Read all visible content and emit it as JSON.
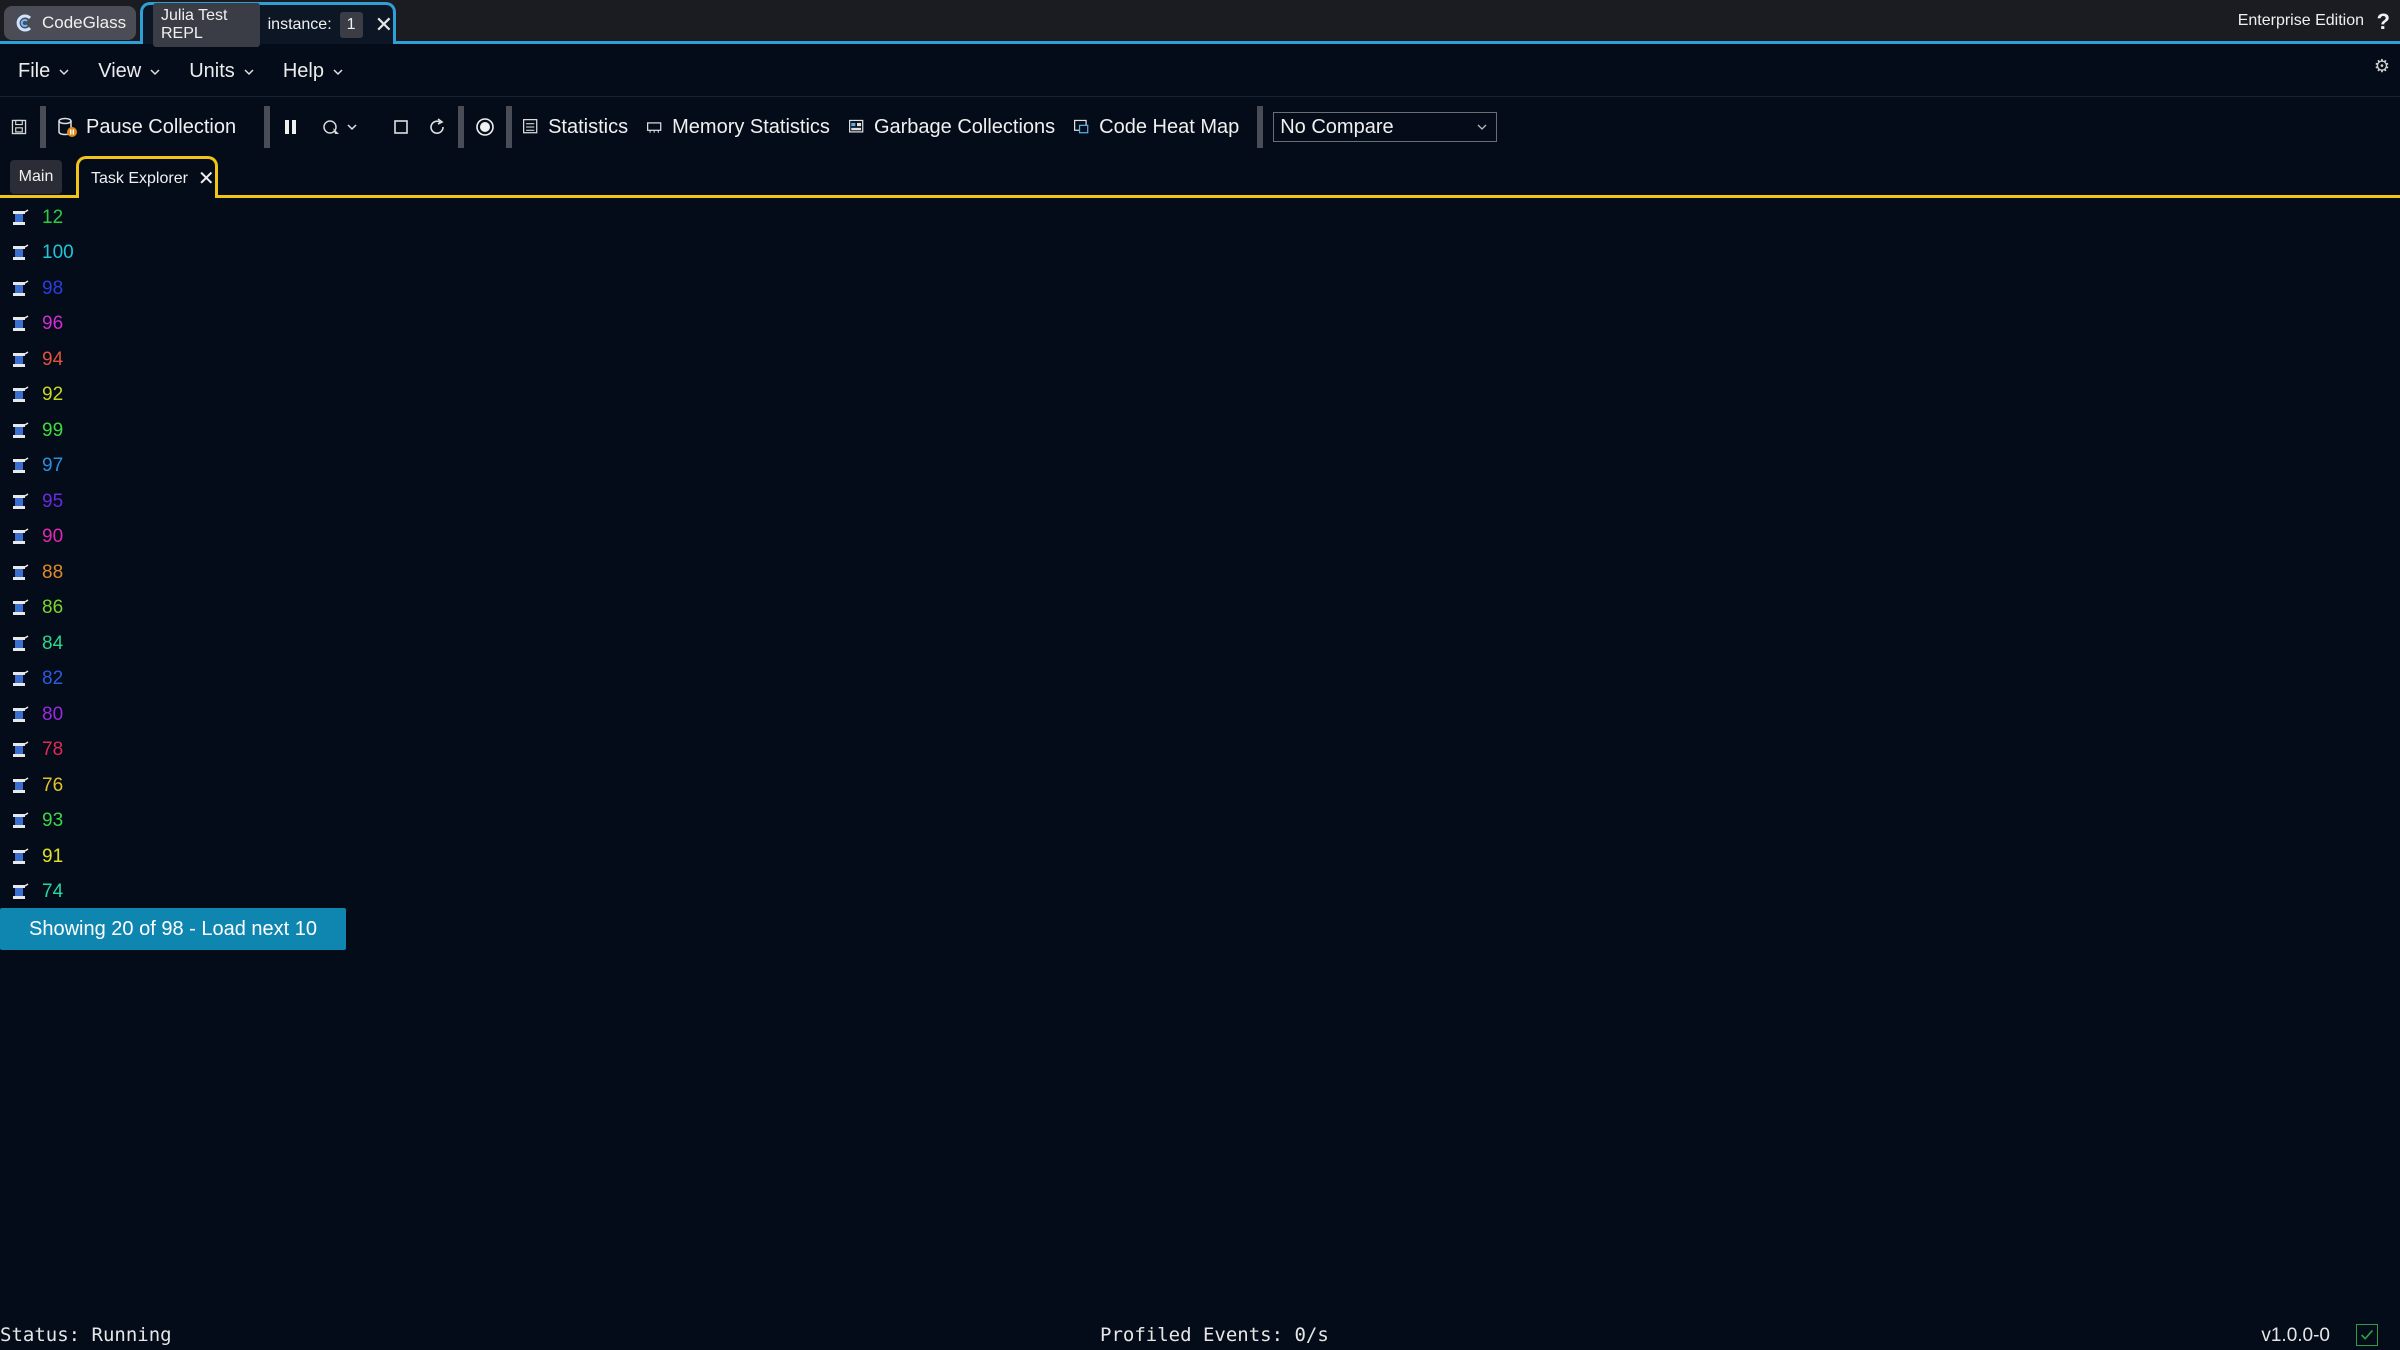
{
  "titlebar": {
    "app_name": "CodeGlass",
    "instance_name": "Julia Test REPL",
    "instance_label": "instance:",
    "instance_count": "1",
    "edition": "Enterprise Edition",
    "help": "?"
  },
  "menu": {
    "items": [
      {
        "label": "File"
      },
      {
        "label": "View"
      },
      {
        "label": "Units"
      },
      {
        "label": "Help"
      }
    ]
  },
  "toolbar": {
    "pause_collection": "Pause Collection",
    "statistics": "Statistics",
    "memory_statistics": "Memory Statistics",
    "garbage_collections": "Garbage Collections",
    "code_heat_map": "Code Heat Map",
    "compare_selected": "No Compare"
  },
  "doc_tabs": {
    "main": "Main",
    "active": "Task Explorer"
  },
  "tasks": [
    {
      "label": "12",
      "color": "#2ecc40"
    },
    {
      "label": "100",
      "color": "#22c4d6"
    },
    {
      "label": "98",
      "color": "#2a3fe0"
    },
    {
      "label": "96",
      "color": "#d42bd4"
    },
    {
      "label": "94",
      "color": "#e0553a"
    },
    {
      "label": "92",
      "color": "#c9d621"
    },
    {
      "label": "99",
      "color": "#3ddc3d"
    },
    {
      "label": "97",
      "color": "#2a8fe0"
    },
    {
      "label": "95",
      "color": "#6a2ae0"
    },
    {
      "label": "90",
      "color": "#e02ab0"
    },
    {
      "label": "88",
      "color": "#e08a2a"
    },
    {
      "label": "86",
      "color": "#7ad62b"
    },
    {
      "label": "84",
      "color": "#2bd68a"
    },
    {
      "label": "82",
      "color": "#2a5ce0"
    },
    {
      "label": "80",
      "color": "#9a2ae0"
    },
    {
      "label": "78",
      "color": "#e02a55"
    },
    {
      "label": "76",
      "color": "#e0c42a"
    },
    {
      "label": "93",
      "color": "#3fd64a"
    },
    {
      "label": "91",
      "color": "#e0e02a"
    },
    {
      "label": "74",
      "color": "#2ad6a0"
    }
  ],
  "load_more": "Showing 20 of 98 - Load next 10",
  "status": {
    "state": "Status: Running",
    "events": "Profiled Events: 0/s",
    "version": "v1.0.0-0"
  },
  "colors": {
    "accent_blue": "#2f9fd6",
    "accent_yellow": "#f0c419",
    "load_button": "#0e86b0",
    "background": "#030c18"
  }
}
